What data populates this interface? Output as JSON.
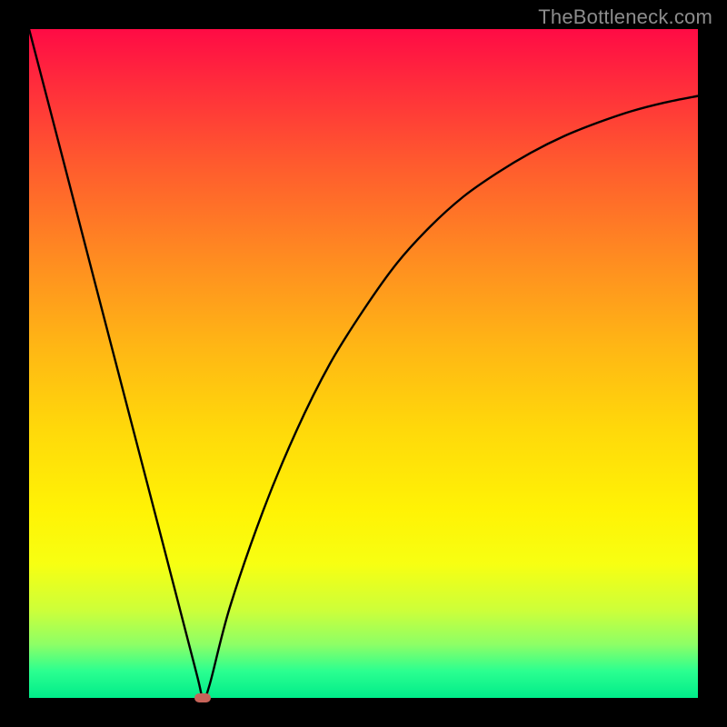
{
  "watermark": "TheBottleneck.com",
  "chart_data": {
    "type": "line",
    "title": "",
    "xlabel": "",
    "ylabel": "",
    "xlim": [
      0,
      100
    ],
    "ylim": [
      0,
      100
    ],
    "series": [
      {
        "name": "bottleneck-curve",
        "x": [
          0,
          5,
          10,
          15,
          20,
          25,
          26,
          27,
          30,
          35,
          40,
          45,
          50,
          55,
          60,
          65,
          70,
          75,
          80,
          85,
          90,
          95,
          100
        ],
        "y": [
          100,
          80.8,
          61.5,
          42.3,
          23.1,
          3.8,
          0,
          2,
          13.5,
          28,
          40,
          50,
          58,
          65,
          70.5,
          75,
          78.5,
          81.5,
          84,
          86,
          87.7,
          89,
          90
        ]
      }
    ],
    "marker": {
      "x": 26,
      "y": 0
    },
    "background_gradient": {
      "top": "#ff0b45",
      "bottom": "#00ec8a"
    }
  }
}
